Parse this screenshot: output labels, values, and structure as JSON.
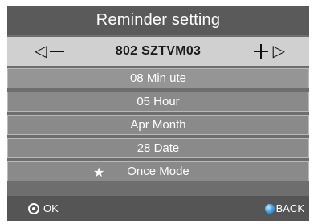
{
  "title": "Reminder setting",
  "channel": {
    "left_arrow": "◁",
    "name": "802 SZTVM03",
    "right_arrow": "▷"
  },
  "rows": [
    {
      "label": "08 Min ute"
    },
    {
      "label": "05 Hour"
    },
    {
      "label": "Apr Month"
    },
    {
      "label": "28 Date"
    },
    {
      "label": "Once Mode",
      "icon": "star-icon",
      "icon_glyph": "★"
    }
  ],
  "footer": {
    "ok_label": "OK",
    "back_label": "BACK",
    "back_color": "#3fa4ec"
  },
  "colors": {
    "title_bar": "#5a5a5a",
    "channel_bar": "#d0d0d0",
    "row_bg": "#8a8a8a",
    "footer_bg": "#555555"
  }
}
